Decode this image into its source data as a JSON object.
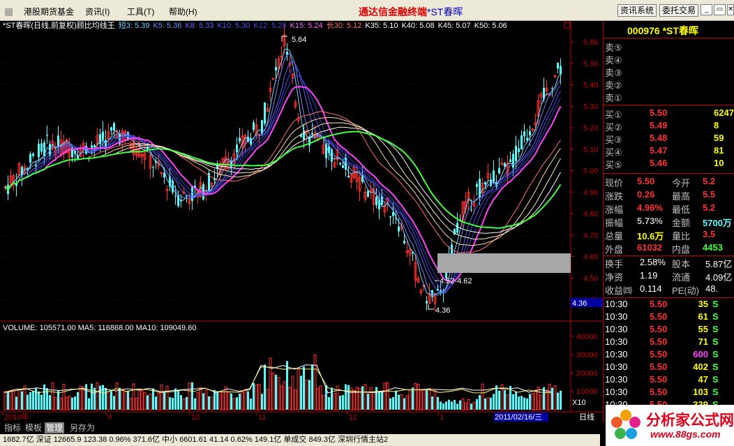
{
  "menu": {
    "item1": "港股期货基金",
    "item2": "资讯(I)",
    "item3": "工具(T)",
    "item4": "帮助(H)",
    "title_red": "通达信金融终端",
    "title_blue": "*ST春晖",
    "btn_news": "资讯系统",
    "btn_order": "委托交易"
  },
  "window_buttons": {
    "min": "_",
    "restore": "▭",
    "close": "✕"
  },
  "chart_header": {
    "title": "*ST春晖(日线,前复权)顾比均线王",
    "items": [
      {
        "label": "短3: 5.39",
        "color": "#66ccff"
      },
      {
        "label": "K5: 5.36",
        "color": "#6699ff"
      },
      {
        "label": "K8: 5.33",
        "color": "#6666ff"
      },
      {
        "label": "K10: 5.30",
        "color": "#5555ee"
      },
      {
        "label": "K12: 5.29",
        "color": "#4444dd"
      },
      {
        "label": "K15: 5.24",
        "color": "#ff66ff"
      },
      {
        "label": "长30: 5.12",
        "color": "#ff6666"
      },
      {
        "label": "K35: 5.10",
        "color": "#ffffff"
      },
      {
        "label": "K40: 5.08",
        "color": "#ffffff"
      },
      {
        "label": "K45: 5.07",
        "color": "#ffffff"
      },
      {
        "label": "K50: 5.06",
        "color": "#ffffff"
      }
    ]
  },
  "price_axis": {
    "ticks": [
      "5.60",
      "5.50",
      "5.40",
      "5.30",
      "5.20",
      "5.10",
      "5.00",
      "4.90",
      "4.80",
      "4.70",
      "4.60",
      "4.50",
      "4.40"
    ],
    "current": "4.36"
  },
  "annotations": {
    "high": "5.64",
    "low": "4.36",
    "range": "4.52-4.62"
  },
  "volume": {
    "header": "VOLUME: 105571.00  MA5: 116868.00  MA10: 109049.60",
    "ticks": [
      "40000",
      "30000",
      "20000",
      "10000"
    ],
    "unit": "X10"
  },
  "x_axis": {
    "labels": [
      "2010年",
      "9",
      "10",
      "11",
      "12",
      "1"
    ],
    "date": "2011/02/16/三",
    "period": "日线"
  },
  "panel": {
    "header": "000976 *ST春晖",
    "sell": [
      {
        "label": "卖⑤",
        "price": "",
        "vol": ""
      },
      {
        "label": "卖④",
        "price": "",
        "vol": ""
      },
      {
        "label": "卖③",
        "price": "",
        "vol": ""
      },
      {
        "label": "卖②",
        "price": "",
        "vol": ""
      },
      {
        "label": "卖①",
        "price": "",
        "vol": ""
      }
    ],
    "buy": [
      {
        "label": "买①",
        "price": "5.50",
        "vol": "6247"
      },
      {
        "label": "买②",
        "price": "5.49",
        "vol": "8"
      },
      {
        "label": "买③",
        "price": "5.48",
        "vol": "59"
      },
      {
        "label": "买④",
        "price": "5.47",
        "vol": "81"
      },
      {
        "label": "买⑤",
        "price": "5.46",
        "vol": "10"
      }
    ],
    "quote": [
      {
        "l1": "现价",
        "v1": "5.50",
        "l2": "今开",
        "v2": "5.2"
      },
      {
        "l1": "涨跌",
        "v1": "0.26",
        "l2": "最高",
        "v2": "5.5"
      },
      {
        "l1": "涨幅",
        "v1": "4.96%",
        "l2": "最低",
        "v2": "5.2"
      },
      {
        "l1": "振幅",
        "v1": "5.73%",
        "l2": "金额",
        "v2": "5700万"
      },
      {
        "l1": "总量",
        "v1": "10.6万",
        "l2": "量比",
        "v2": "3.5"
      },
      {
        "l1": "外盘",
        "v1": "61032",
        "l2": "内盘",
        "v2": "4453"
      }
    ],
    "stats": [
      {
        "l1": "换手",
        "v1": "2.58%",
        "l2": "股本",
        "v2": "5.87亿"
      },
      {
        "l1": "净资",
        "v1": "1.19",
        "l2": "流通",
        "v2": "4.09亿"
      },
      {
        "l1": "收益㈣",
        "v1": "0.114",
        "l2": "PE(动)",
        "v2": "48."
      }
    ],
    "ticks": [
      {
        "time": "10:30",
        "price": "5.50",
        "vol": "35",
        "side": "S"
      },
      {
        "time": "10:30",
        "price": "5.50",
        "vol": "61",
        "side": "S"
      },
      {
        "time": "10:30",
        "price": "5.50",
        "vol": "55",
        "side": "S"
      },
      {
        "time": "10:30",
        "price": "5.50",
        "vol": "71",
        "side": "S"
      },
      {
        "time": "10:30",
        "price": "5.50",
        "vol": "600",
        "side": "S"
      },
      {
        "time": "10:30",
        "price": "5.50",
        "vol": "402",
        "side": "S"
      },
      {
        "time": "10:30",
        "price": "5.50",
        "vol": "47",
        "side": "S"
      },
      {
        "time": "10:30",
        "price": "5.50",
        "vol": "103",
        "side": "S"
      },
      {
        "time": "10:30",
        "price": "5.50",
        "vol": "339",
        "side": "S"
      }
    ]
  },
  "tabs": {
    "t1": "指标",
    "t2": "模板",
    "t3": "管理",
    "t4": "另存为"
  },
  "statusbar": "1682.7亿 深证 12665.9  123.38  0.96%  371.6亿  中小 6601.61  41.14  0.62%  149.1亿  单成交  849.3亿  深圳行情主站2",
  "logo": {
    "text": "分析家公式网",
    "url": "www.88gs.com"
  }
}
